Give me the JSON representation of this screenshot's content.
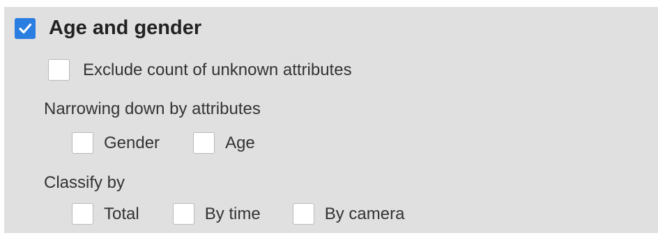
{
  "section": {
    "label": "Age and gender",
    "checked": true
  },
  "exclude_unknown": {
    "label": "Exclude count of unknown attributes",
    "checked": false
  },
  "narrowing": {
    "heading": "Narrowing down by attributes",
    "options": [
      {
        "label": "Gender",
        "checked": false
      },
      {
        "label": "Age",
        "checked": false
      }
    ]
  },
  "classify": {
    "heading": "Classify by",
    "options": [
      {
        "label": "Total",
        "checked": false
      },
      {
        "label": "By time",
        "checked": false
      },
      {
        "label": "By camera",
        "checked": false
      }
    ]
  },
  "colors": {
    "panel_background": "#e0e0e0",
    "checkbox_accent": "#2a7de1",
    "checkbox_border": "#b9b9b9",
    "text": "#333333"
  },
  "icons": {
    "checked_mark": "checkmark-icon"
  }
}
